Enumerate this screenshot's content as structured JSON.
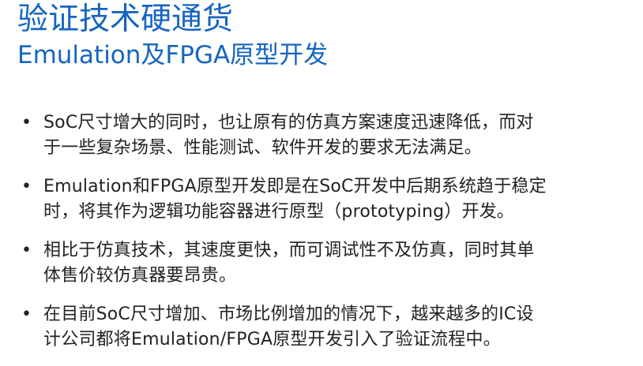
{
  "slide": {
    "title": "验证技术硬通货",
    "subtitle": "Emulation及FPGA原型开发",
    "bullets": [
      {
        "lines": [
          "SoC尺寸增大的同时，也让原有的仿真方案速度迅速降低，而对",
          "于一些复杂场景、性能测试、软件开发的要求无法满足。"
        ]
      },
      {
        "lines": [
          "Emulation和FPGA原型开发即是在SoC开发中后期系统趋于稳定",
          "时，将其作为逻辑功能容器进行原型（prototyping）开发。"
        ]
      },
      {
        "lines": [
          "相比于仿真技术，其速度更快，而可调试性不及仿真，同时其单",
          "体售价较仿真器要昂贵。"
        ]
      },
      {
        "lines": [
          "在目前SoC尺寸增加、市场比例增加的情况下，越来越多的IC设",
          "计公司都将Emulation/FPGA原型开发引入了验证流程中。"
        ]
      }
    ],
    "bullet_marker": "•",
    "colors": {
      "title": "#1565c0",
      "body_text": "#222222",
      "background": "#ffffff"
    }
  }
}
